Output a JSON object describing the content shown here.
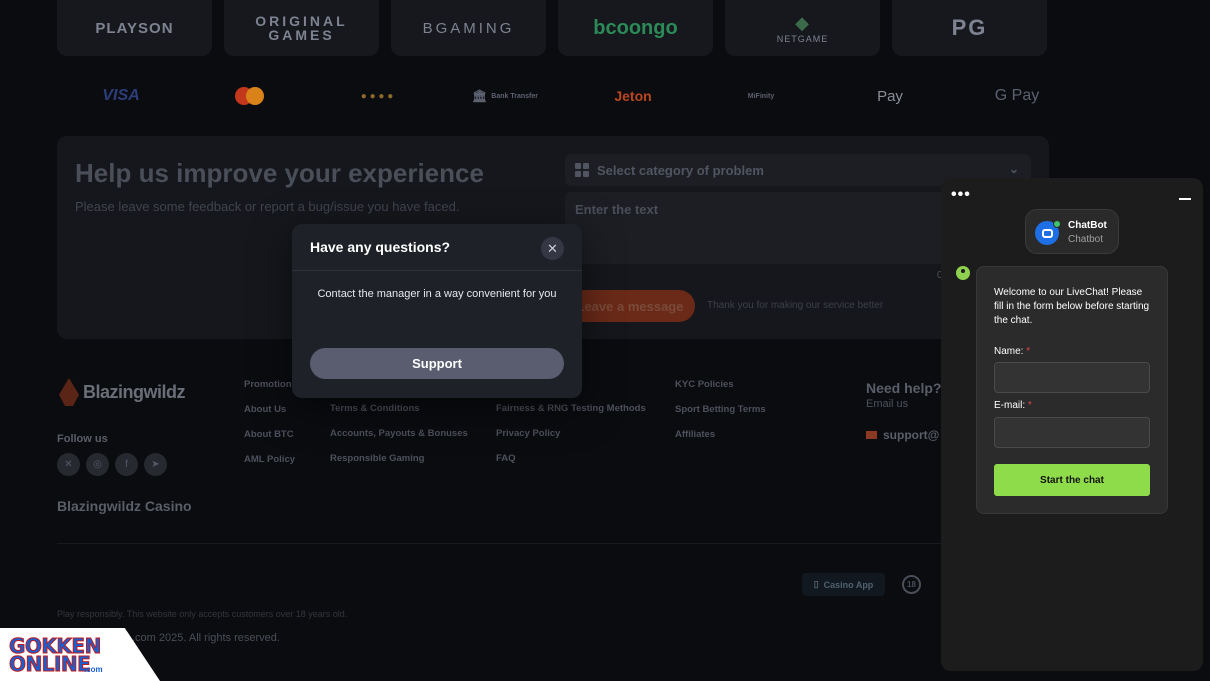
{
  "providers": [
    "PLAYSON",
    "ORIGINAL GAMES",
    "BGAMING",
    "bcoongo",
    "NETGAME",
    "PG"
  ],
  "payments": [
    "VISA",
    "Bank Transfer",
    "Jeton",
    "MiFinity",
    "Pay",
    "G Pay"
  ],
  "feedback": {
    "title": "Help us improve your experience",
    "subtitle": "Please leave some feedback or report a bug/issue you have faced.",
    "category_placeholder": "Select category of problem",
    "text_placeholder": "Enter the text",
    "counter": "0",
    "submit_label": "Leave a message",
    "thanks": "Thank you for making our service better"
  },
  "footer": {
    "brand": "Blazingwildz",
    "follow_label": "Follow us",
    "casino_name": "Blazingwildz Casino",
    "col1": [
      "Promotions",
      "About Us",
      "About BTC",
      "AML Policy"
    ],
    "col2": [
      "Terms & Conditions",
      "Accounts, Payouts & Bonuses",
      "Responsible Gaming"
    ],
    "col3": [
      "Fairness & RNG Testing Methods",
      "Privacy Policy",
      "FAQ"
    ],
    "col4": [
      "KYC Policies",
      "Sport Betting Terms",
      "Affiliates"
    ],
    "need_help": "Need help?",
    "email_us": "Email us",
    "support_email": "support@",
    "casino_app": "Casino App",
    "age_badge": "18",
    "responsible_text": "Play responsibly. This website only accepts customers over 18 years old.",
    "copyright": ".com 2025. All rights reserved."
  },
  "watermark": {
    "line1": "GOKKEN",
    "line2": "ONLINE",
    "suffix": ".com"
  },
  "modal": {
    "title": "Have any questions?",
    "close_glyph": "✕",
    "message": "Contact the manager in a way convenient for you",
    "button_label": "Support"
  },
  "chat": {
    "menu_glyph": "•••",
    "agent_name": "ChatBot",
    "agent_role": "Chatbot",
    "welcome": "Welcome to our LiveChat! Please fill in the form below before starting the chat.",
    "name_label": "Name:",
    "email_label": "E-mail:",
    "required_mark": "*",
    "name_value": "",
    "email_value": "",
    "start_label": "Start the chat"
  },
  "colors": {
    "accent_green": "#8fdc4a",
    "accent_orange": "#6b2a18",
    "chat_blue": "#1e6fe6"
  }
}
